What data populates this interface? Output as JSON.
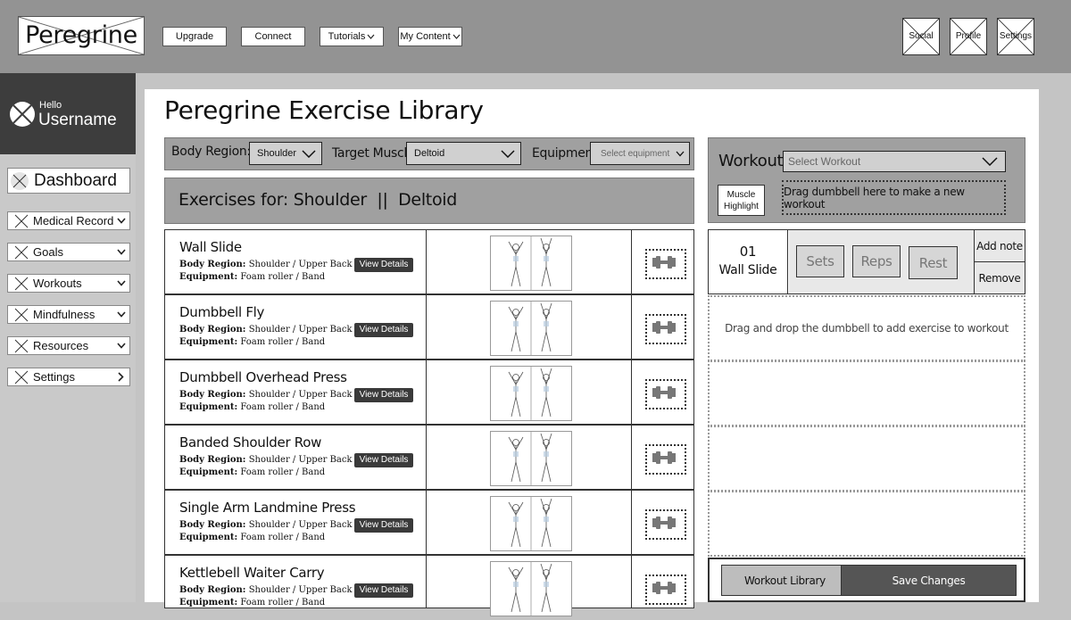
{
  "header": {
    "logo": "Peregrine",
    "nav": [
      {
        "label": "Upgrade",
        "chevron": false
      },
      {
        "label": "Connect",
        "chevron": false
      },
      {
        "label": "Tutorials",
        "chevron": true
      },
      {
        "label": "My Content",
        "chevron": true
      }
    ],
    "right": [
      "Social",
      "Profile",
      "Settings"
    ]
  },
  "sidebar": {
    "greeting": "Hello",
    "username": "Username",
    "dashboard": "Dashboard",
    "items": [
      {
        "label": "Medical Record",
        "chevron": "down"
      },
      {
        "label": "Goals",
        "chevron": "down"
      },
      {
        "label": "Workouts",
        "chevron": "down"
      },
      {
        "label": "Mindfulness",
        "chevron": "down"
      },
      {
        "label": "Resources",
        "chevron": "down"
      },
      {
        "label": "Settings",
        "chevron": "right"
      }
    ]
  },
  "main": {
    "title": "Peregrine Exercise Library",
    "filters": {
      "body_region_label": "Body Region:",
      "body_region_value": "Shoulder",
      "target_muscle_label": "Target Muscle:",
      "target_muscle_value": "Deltoid",
      "equipment_label": "Equipment:",
      "equipment_placeholder": "Select equipment"
    },
    "exercises_for": "Exercises for: Shoulder  ||  Deltoid",
    "body_region_key": "Body Region:",
    "equipment_key": "Equipment:",
    "view_details": "View Details",
    "exercises": [
      {
        "name": "Wall Slide",
        "body_region": "Shoulder / Upper Back",
        "equipment": "Foam roller / Band"
      },
      {
        "name": "Dumbbell Fly",
        "body_region": "Shoulder / Upper Back",
        "equipment": "Foam roller / Band"
      },
      {
        "name": "Dumbbell Overhead Press",
        "body_region": "Shoulder / Upper Back",
        "equipment": "Foam roller / Band"
      },
      {
        "name": "Banded Shoulder Row",
        "body_region": "Shoulder / Upper Back",
        "equipment": "Foam roller / Band"
      },
      {
        "name": "Single Arm Landmine Press",
        "body_region": "Shoulder / Upper Back",
        "equipment": "Foam roller / Band"
      },
      {
        "name": "Kettlebell Waiter Carry",
        "body_region": "Shoulder / Upper Back",
        "equipment": "Foam roller / Band"
      }
    ]
  },
  "workout": {
    "label": "Workout:",
    "select_placeholder": "Select Workout",
    "muscle_highlight": "Muscle Highlight",
    "drag_new": "Drag dumbbell here to make a new workout",
    "entry": {
      "number": "01",
      "name": "Wall Slide",
      "sets": "Sets",
      "reps": "Reps",
      "rest": "Rest",
      "add_note": "Add note",
      "remove": "Remove"
    },
    "drop_hint": "Drag and drop the dumbbell to add exercise to workout",
    "workout_library": "Workout Library",
    "save_changes": "Save Changes"
  },
  "icons": [
    "x-placeholder-icon",
    "chevron-down-icon",
    "chevron-right-icon",
    "dumbbell-icon"
  ]
}
